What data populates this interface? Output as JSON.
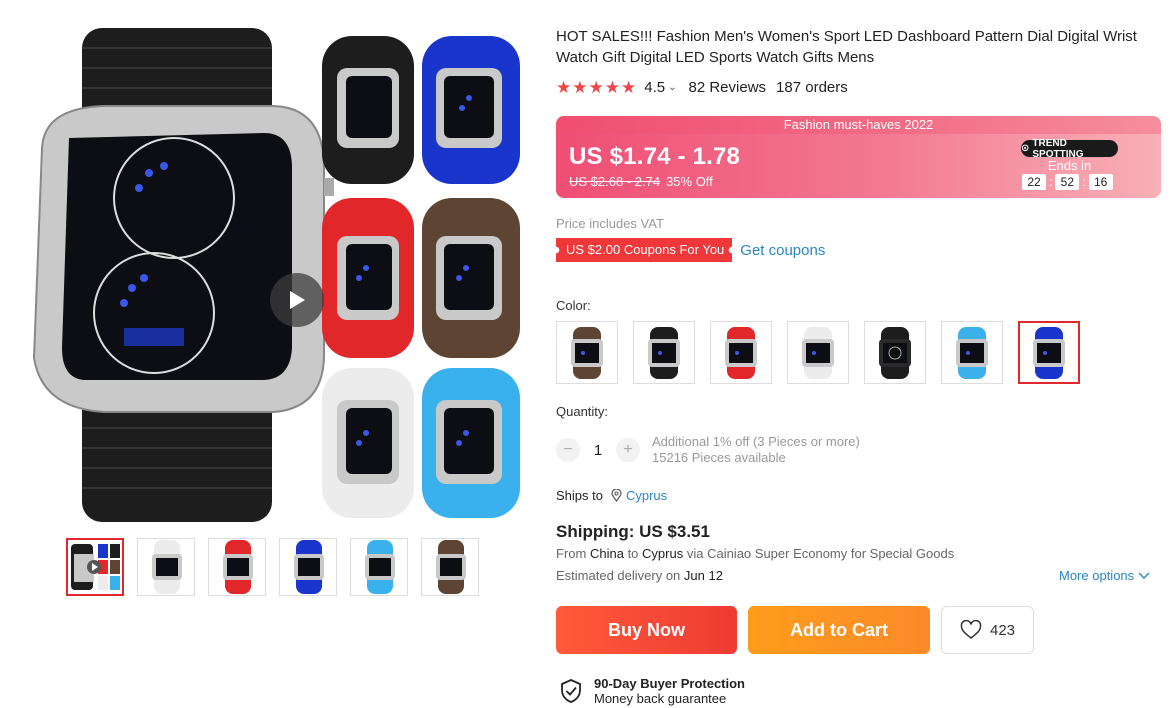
{
  "product": {
    "title": "HOT SALES!!! Fashion Men's Women's Sport LED Dashboard Pattern Dial Digital Wrist Watch Gift Digital LED Sports Watch Gifts Mens",
    "rating_score": "4.5",
    "reviews": "82 Reviews",
    "orders": "187 orders"
  },
  "price": {
    "banner": "Fashion must-haves 2022",
    "current": "US $1.74 - 1.78",
    "original": "US $2.68 - 2.74",
    "discount": "35% Off",
    "trend_label": "TREND SPOTTING",
    "ends_in": "Ends in",
    "timer": {
      "h": "22",
      "m": "52",
      "s": "16"
    }
  },
  "vat_note": "Price includes VAT",
  "coupon": {
    "badge": "US $2.00 Coupons For You",
    "link": "Get coupons"
  },
  "color": {
    "label": "Color:",
    "options": [
      "brown",
      "black",
      "red",
      "white",
      "black-dial",
      "sky-blue",
      "blue"
    ],
    "selected": "blue"
  },
  "quantity": {
    "label": "Quantity:",
    "value": "1",
    "minus": "−",
    "plus": "+",
    "discount_note": "Additional 1% off (3 Pieces or more)",
    "available": "15216 Pieces available"
  },
  "ships_to": {
    "label": "Ships to",
    "country": "Cyprus"
  },
  "shipping": {
    "price": "Shipping: US $3.51",
    "from_prefix": "From",
    "from_country": "China",
    "to_word": "to",
    "to_country": "Cyprus",
    "via": "via Cainiao Super Economy for Special Goods",
    "est_prefix": "Estimated delivery on",
    "est_date": "Jun 12",
    "more_options": "More options"
  },
  "actions": {
    "buy_now": "Buy Now",
    "add_to_cart": "Add to Cart",
    "wishlist_count": "423"
  },
  "protection": {
    "title": "90-Day Buyer Protection",
    "subtitle": "Money back guarantee"
  },
  "colors": {
    "accent": "#e0282e",
    "link": "#2a86c3",
    "buy": "#ee3b33",
    "cart": "#fb8a2a",
    "star": "#f04646"
  }
}
